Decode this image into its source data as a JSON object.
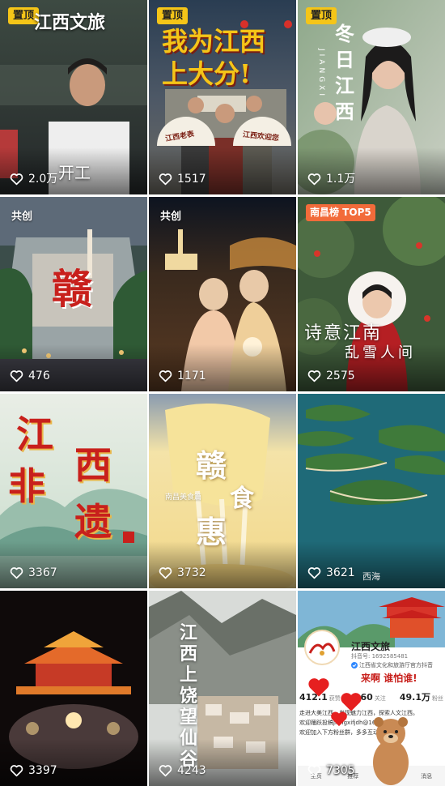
{
  "videos": [
    {
      "badge": "置顶",
      "title": "江西文旅",
      "caption": "开工",
      "likes": "2.0万"
    },
    {
      "badge": "置顶",
      "title": "我为江西上大分!",
      "title_line1": "我为江西",
      "title_line2": "上大分!",
      "fan_left": "江西老表",
      "fan_right": "江西欢迎您",
      "likes": "1517"
    },
    {
      "badge": "置顶",
      "title": "冬日江西",
      "title_chars": [
        "冬",
        "日",
        "江",
        "西"
      ],
      "subtitle": "JIANGXI",
      "likes": "1.1万"
    },
    {
      "tag": "共创",
      "title": "赣",
      "likes": "476"
    },
    {
      "tag": "共创",
      "likes": "1171"
    },
    {
      "tag": "南昌榜 TOP5",
      "title": "诗意江南",
      "caption": "乱雪人间",
      "likes": "2575"
    },
    {
      "title_chars": [
        "江",
        "西",
        "非",
        "遗"
      ],
      "likes": "3367"
    },
    {
      "title": "赣食惠",
      "title_chars": [
        "赣",
        "食",
        "惠"
      ],
      "subtitle": "南昌美食篇",
      "likes": "3732"
    },
    {
      "caption": "西海",
      "likes": "3621"
    },
    {
      "likes": "3397"
    },
    {
      "title": "江西上饶望仙谷",
      "title_chars": [
        "江",
        "西",
        "上",
        "饶",
        "望",
        "仙",
        "谷"
      ],
      "likes": "4243"
    },
    {
      "profile": {
        "name": "江西文旅",
        "id_text": "抖音号: 1692585481",
        "desc": "江西省文化和旅游厅官方抖音",
        "slogan": "来啊 谁怕谁!",
        "stats": [
          {
            "value": "412.1",
            "label": "获赞"
          },
          {
            "value": "160",
            "label": "关注"
          },
          {
            "value": "49.1万",
            "label": "粉丝"
          }
        ],
        "bio1": "走进大美江西，发现魅力江西，探索人文江西。",
        "bio2": "欢迎踊跃投稿jiangxifjdh@163.com",
        "bio3": "欢迎加入下方粉丝群，多多互动",
        "tabs": [
          "主页",
          "推荐",
          "商城",
          "消息"
        ]
      },
      "likes": "7305"
    }
  ],
  "colors": {
    "pin_badge": "#f5c518",
    "rank_badge": "#f26b3a",
    "calligraphy_red": "#c8201c"
  }
}
